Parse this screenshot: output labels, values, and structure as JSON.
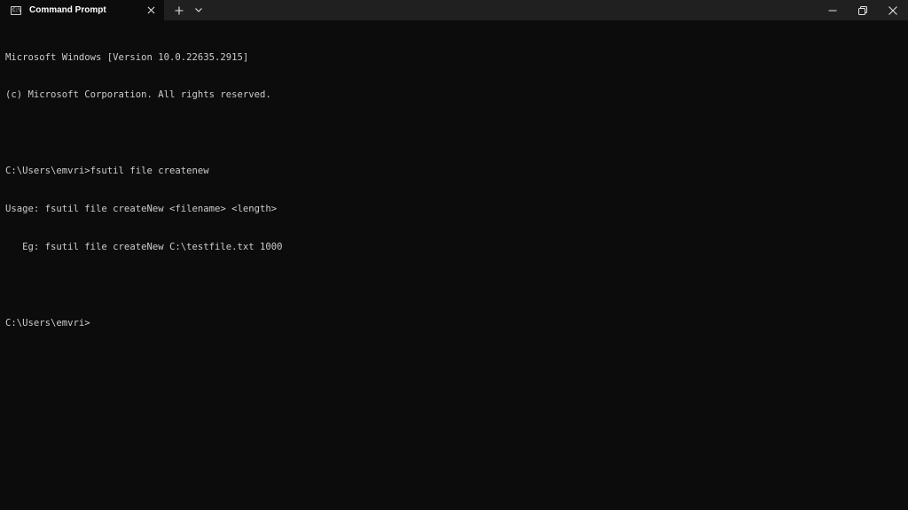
{
  "window": {
    "tab_title": "Command Prompt",
    "tab_icon": "command-prompt-icon",
    "tab_icon_glyph": "C:\\",
    "close_tab_icon": "close-icon",
    "new_tab_icon": "plus-icon",
    "dropdown_icon": "chevron-down-icon",
    "minimize_icon": "minimize-icon",
    "restore_icon": "restore-icon",
    "close_window_icon": "close-icon"
  },
  "terminal": {
    "lines": [
      "Microsoft Windows [Version 10.0.22635.2915]",
      "(c) Microsoft Corporation. All rights reserved.",
      "",
      "C:\\Users\\emvri>fsutil file createnew",
      "Usage: fsutil file createNew <filename> <length>",
      "   Eg: fsutil file createNew C:\\testfile.txt 1000",
      "",
      "C:\\Users\\emvri>"
    ]
  },
  "colors": {
    "background": "#0c0c0c",
    "titlebar": "#202020",
    "text": "#cccccc"
  }
}
